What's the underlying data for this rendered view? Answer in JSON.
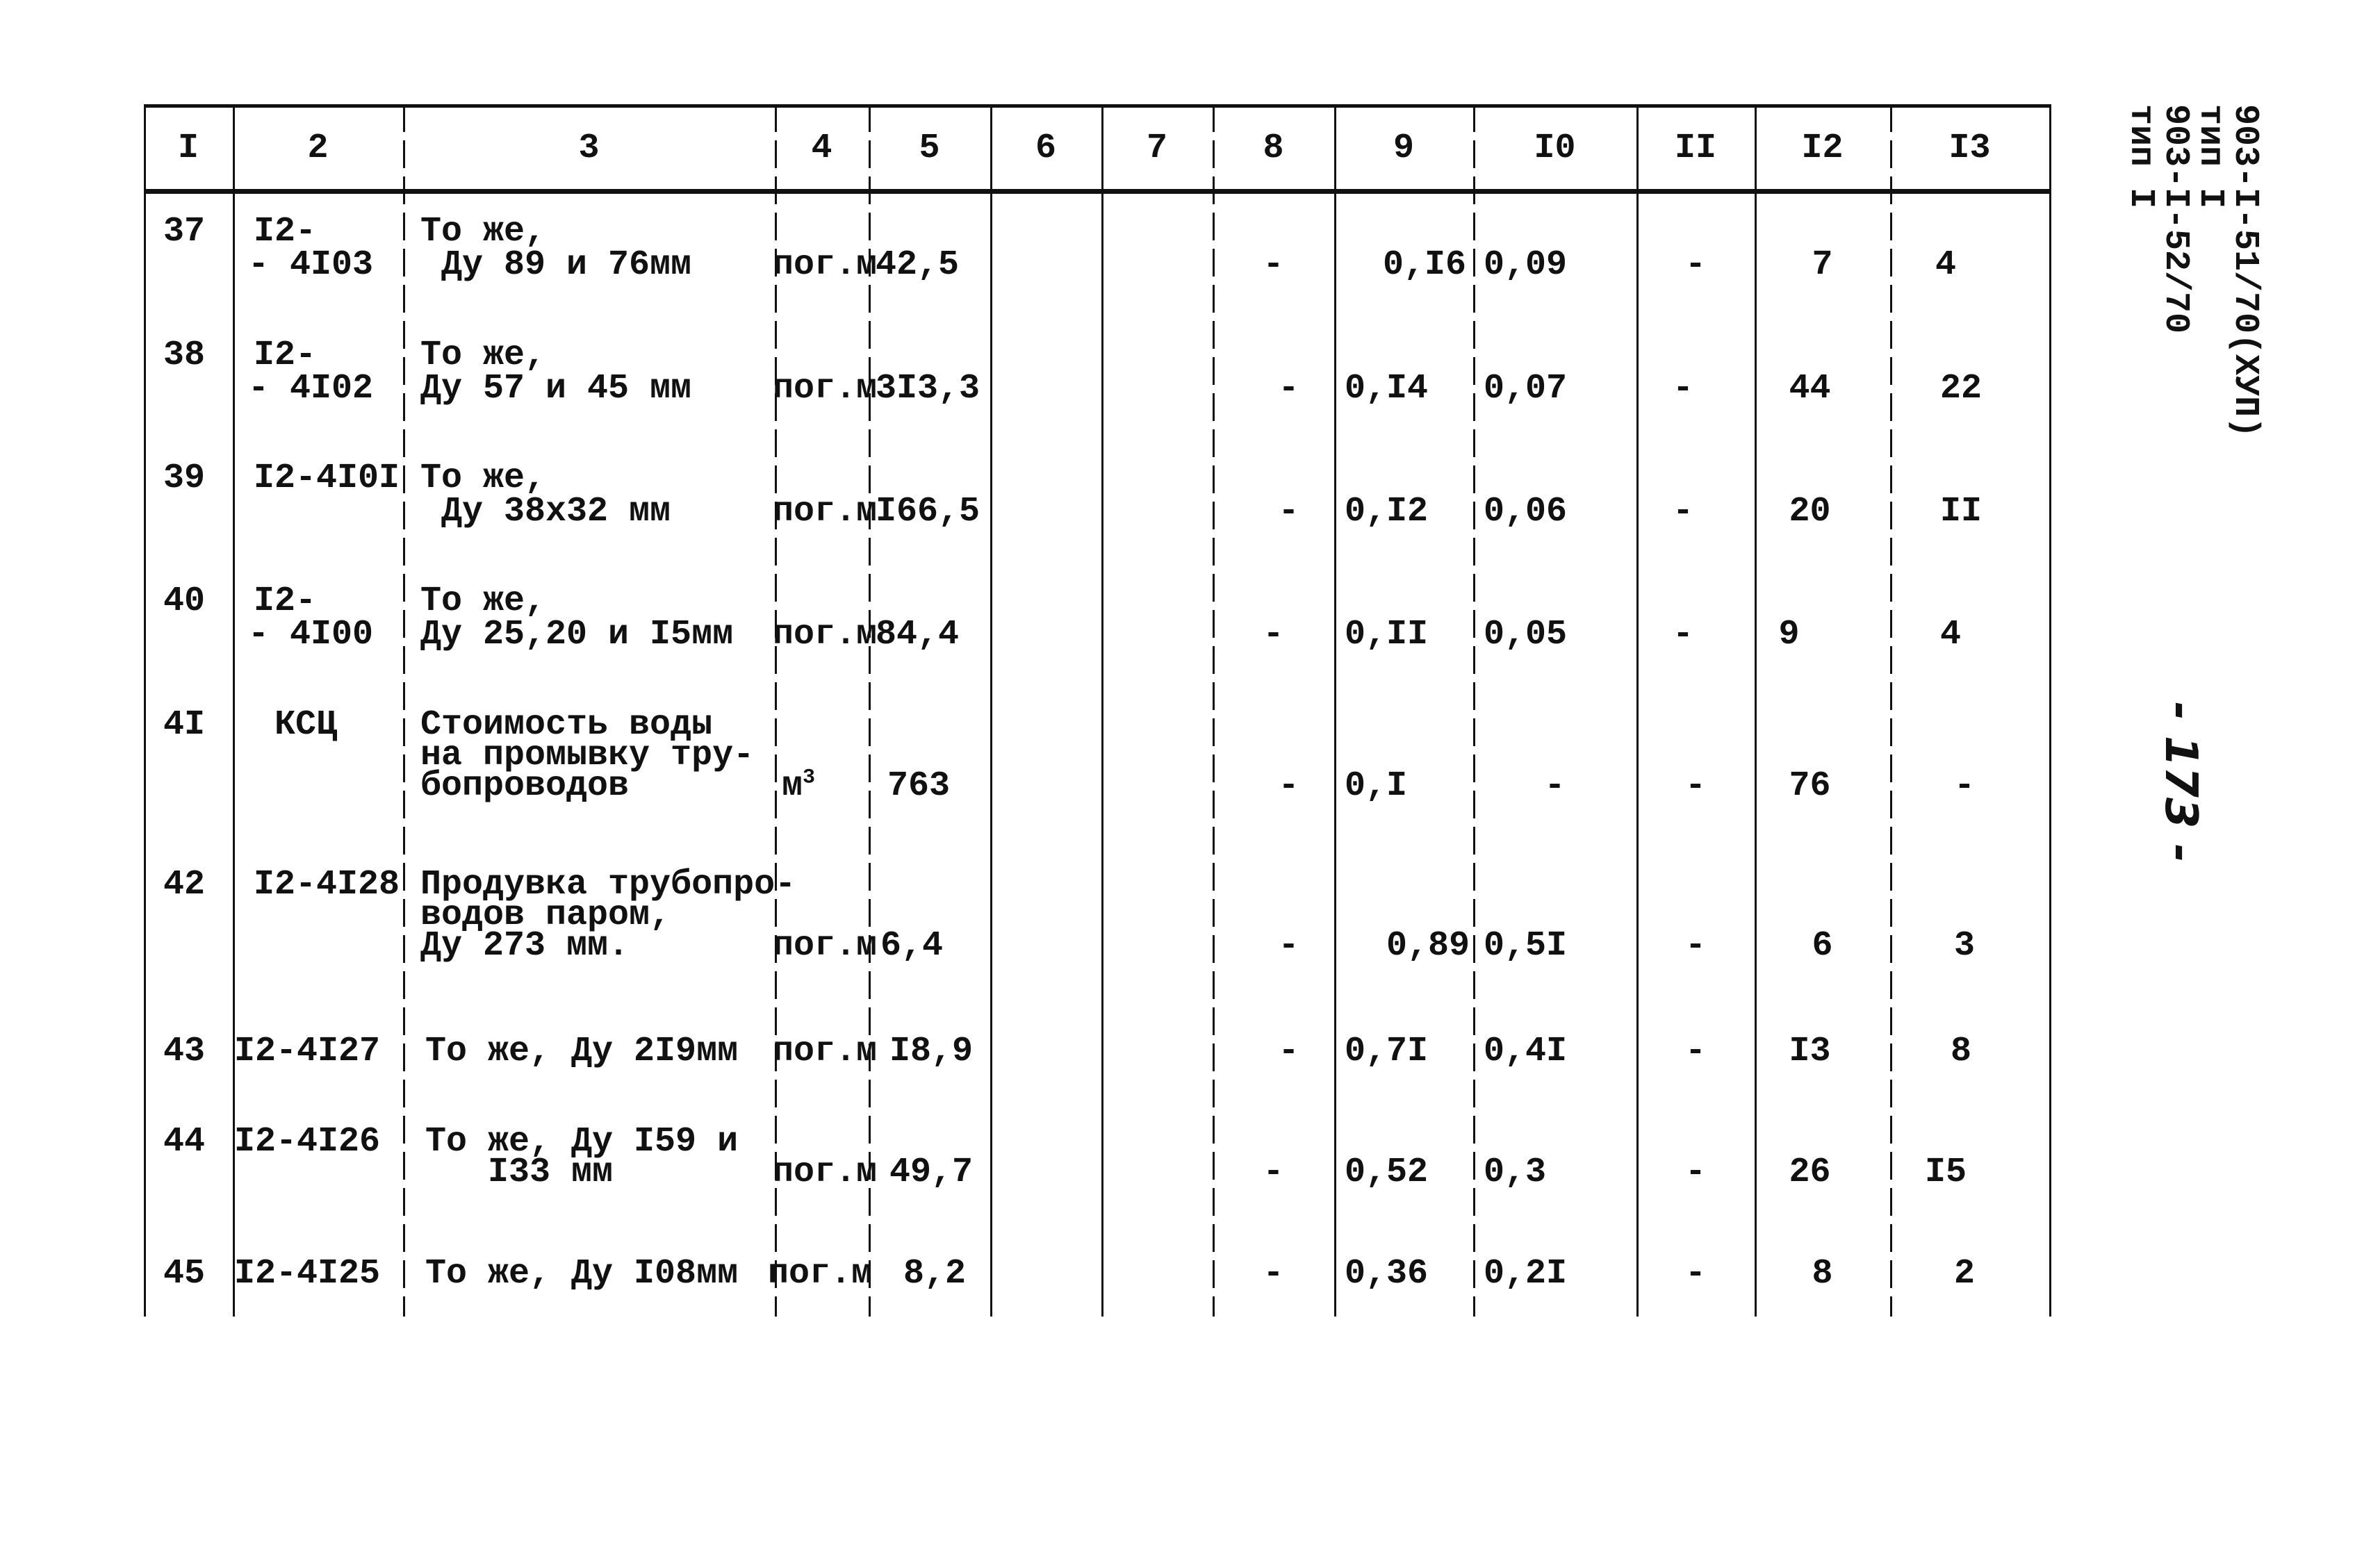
{
  "document": {
    "side_labels": [
      "903-I-51/70(ХУП)",
      "тип I",
      "903-I-52/70",
      "тип I"
    ],
    "page_number": "- 173 -"
  },
  "table": {
    "headers": [
      "I",
      "2",
      "3",
      "4",
      "5",
      "6",
      "7",
      "8",
      "9",
      "I0",
      "II",
      "I2",
      "I3"
    ],
    "rows": [
      {
        "n": "37",
        "code": [
          "I2-",
          "- 4I03"
        ],
        "desc": [
          "То же,",
          " Ду 89 и 76мм"
        ],
        "unit": "пог.м",
        "qty": "42,5",
        "c6": "",
        "c7": "",
        "c8": "-",
        "c9": "0,I6",
        "c10": "0,09",
        "c11": "-",
        "c12": "7",
        "c13": "4"
      },
      {
        "n": "38",
        "code": [
          "I2-",
          "- 4I02"
        ],
        "desc": [
          "То же,",
          "Ду 57 и 45 мм"
        ],
        "unit": "пог.м",
        "qty": "3I3,3",
        "c6": "",
        "c7": "",
        "c8": "-",
        "c9": "0,I4",
        "c10": "0,07",
        "c11": "-",
        "c12": "44",
        "c13": "22"
      },
      {
        "n": "39",
        "code": [
          "I2-4I0I"
        ],
        "desc": [
          "То же,",
          " Ду 38х32 мм"
        ],
        "unit": "пог.м",
        "qty": "I66,5",
        "c6": "",
        "c7": "",
        "c8": "-",
        "c9": "0,I2",
        "c10": "0,06",
        "c11": "-",
        "c12": "20",
        "c13": "II"
      },
      {
        "n": "40",
        "code": [
          "I2-",
          "- 4I00"
        ],
        "desc": [
          "То же,",
          "Ду 25,20 и I5мм"
        ],
        "unit": "пог.м",
        "qty": "84,4",
        "c6": "",
        "c7": "",
        "c8": "-",
        "c9": "0,II",
        "c10": "0,05",
        "c11": "-",
        "c12": "9",
        "c13": "4"
      },
      {
        "n": "4I",
        "code": [
          "КСЦ"
        ],
        "desc": [
          "Стоимость воды",
          "на промывку тру-",
          "бопроводов"
        ],
        "unit": "м",
        "unit_sup": "3",
        "qty": "763",
        "c6": "",
        "c7": "",
        "c8": "-",
        "c9": "0,I",
        "c10": "-",
        "c11": "-",
        "c12": "76",
        "c13": "-"
      },
      {
        "n": "42",
        "code": [
          "I2-4I28"
        ],
        "desc": [
          "Продувка трубопро-",
          "водов паром,",
          "Ду 273 мм."
        ],
        "unit": "пог.м",
        "qty": "6,4",
        "c6": "",
        "c7": "",
        "c8": "-",
        "c9": "0,89",
        "c10": "0,5I",
        "c11": "-",
        "c12": "6",
        "c13": "3"
      },
      {
        "n": "43",
        "code": [
          "I2-4I27"
        ],
        "desc": [
          "То же, Ду 2I9мм"
        ],
        "unit": "пог.м",
        "qty": "I8,9",
        "c6": "",
        "c7": "",
        "c8": "-",
        "c9": "0,7I",
        "c10": "0,4I",
        "c11": "-",
        "c12": "I3",
        "c13": "8"
      },
      {
        "n": "44",
        "code": [
          "I2-4I26"
        ],
        "desc": [
          "То же, Ду I59 и",
          "   I33 мм"
        ],
        "unit": "пог.м",
        "qty": "49,7",
        "c6": "",
        "c7": "",
        "c8": "-",
        "c9": "0,52",
        "c10": "0,3",
        "c11": "-",
        "c12": "26",
        "c13": "I5"
      },
      {
        "n": "45",
        "code": [
          "I2-4I25"
        ],
        "desc": [
          "То же, Ду I08мм"
        ],
        "unit": "пог.м",
        "qty": "8,2",
        "c6": "",
        "c7": "",
        "c8": "-",
        "c9": "0,36",
        "c10": "0,2I",
        "c11": "-",
        "c12": "8",
        "c13": "2"
      }
    ]
  }
}
